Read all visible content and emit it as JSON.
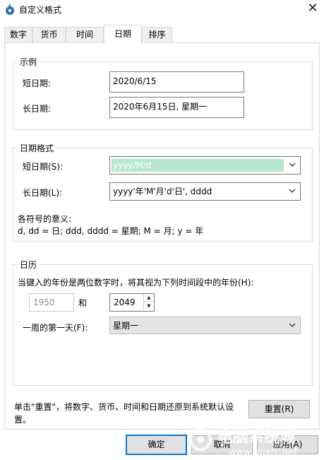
{
  "window": {
    "title": "自定义格式",
    "close_glyph": "✕"
  },
  "tabs": [
    {
      "label": "数字"
    },
    {
      "label": "货币"
    },
    {
      "label": "时间"
    },
    {
      "label": "日期"
    },
    {
      "label": "排序"
    }
  ],
  "example": {
    "title": "示例",
    "short_label": "短日期:",
    "short_value": "2020/6/15",
    "long_label": "长日期:",
    "long_value": "2020年6月15日, 星期一"
  },
  "date_format": {
    "title": "日期格式",
    "short_label": "短日期(S):",
    "short_value": "yyyy/M/d",
    "long_label": "长日期(L):",
    "long_value": "yyyy'年'M'月'd'日', dddd",
    "legend_title": "各符号的意义:",
    "legend_text": "d, dd = 日;  ddd, dddd = 星期;  M = 月;  y = 年"
  },
  "calendar": {
    "title": "日历",
    "desc": "当键入的年份是两位数字时，将其视为下列时间段中的年份(H):",
    "from_year": "1950",
    "and_label": "和",
    "to_year": "2049",
    "first_day_label": "一周的第一天(F):",
    "first_day_value": "星期一"
  },
  "footer": {
    "reset_note_line1": "单击\"重置\"，将数字、货币、时间和日期还原到系统默认设",
    "reset_note_line2": "置。",
    "reset_button": "重置(R)"
  },
  "buttons": {
    "ok": "确定",
    "cancel": "取消",
    "apply": "应用(A)"
  },
  "watermark": {
    "text": "电脑系统城",
    "url": "www.dnxtc.net"
  },
  "colors": {
    "selection": "#b7e6d2",
    "default_button_border": "#0078d7"
  }
}
